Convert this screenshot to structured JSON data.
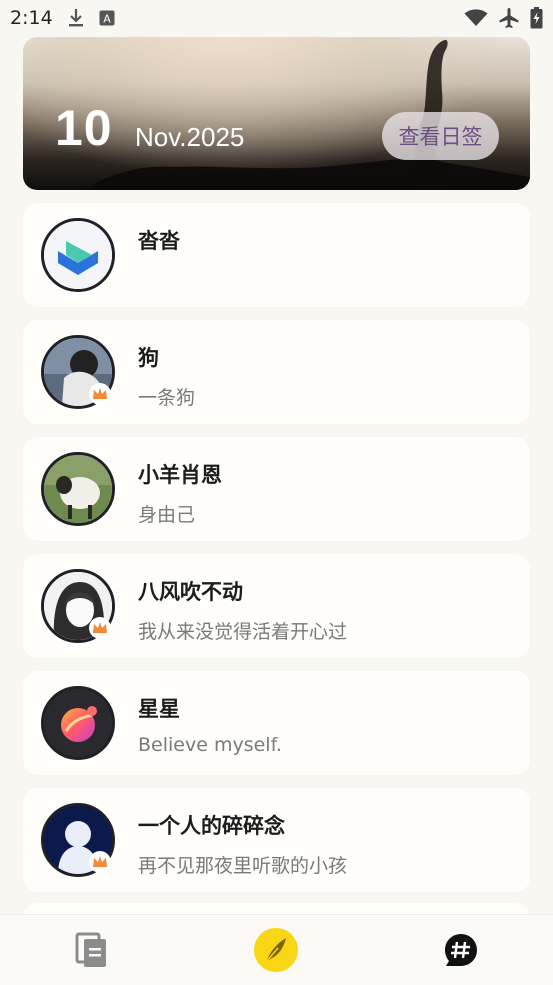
{
  "status_bar": {
    "time": "2:14",
    "icons": [
      "download-icon",
      "keyboard-a-icon",
      "wifi-icon",
      "airplane-icon",
      "battery-charging-icon"
    ]
  },
  "banner": {
    "day": "10",
    "month_year": "Nov.2025",
    "button_label": "查看日签"
  },
  "list": {
    "items": [
      {
        "name": "沓沓",
        "subtitle": "",
        "avatar": "logo-avatar",
        "crown": false
      },
      {
        "name": "狗",
        "subtitle": "一条狗",
        "avatar": "photo-avatar",
        "crown": true
      },
      {
        "name": "小羊肖恩",
        "subtitle": "身由己",
        "avatar": "sheep-avatar",
        "crown": false
      },
      {
        "name": "八风吹不动",
        "subtitle": "我从来没觉得活着开心过",
        "avatar": "anime-avatar",
        "crown": true
      },
      {
        "name": "星星",
        "subtitle": "Believe myself.",
        "avatar": "planet-avatar",
        "crown": false
      },
      {
        "name": "一个人的碎碎念",
        "subtitle": "再不见那夜里听歌的小孩",
        "avatar": "silhouette-avatar",
        "crown": true
      }
    ]
  },
  "bottom_nav": {
    "items": [
      "notes-icon",
      "feather-icon",
      "hashtag-chat-icon"
    ],
    "colors": {
      "accent": "#f9d616"
    }
  }
}
